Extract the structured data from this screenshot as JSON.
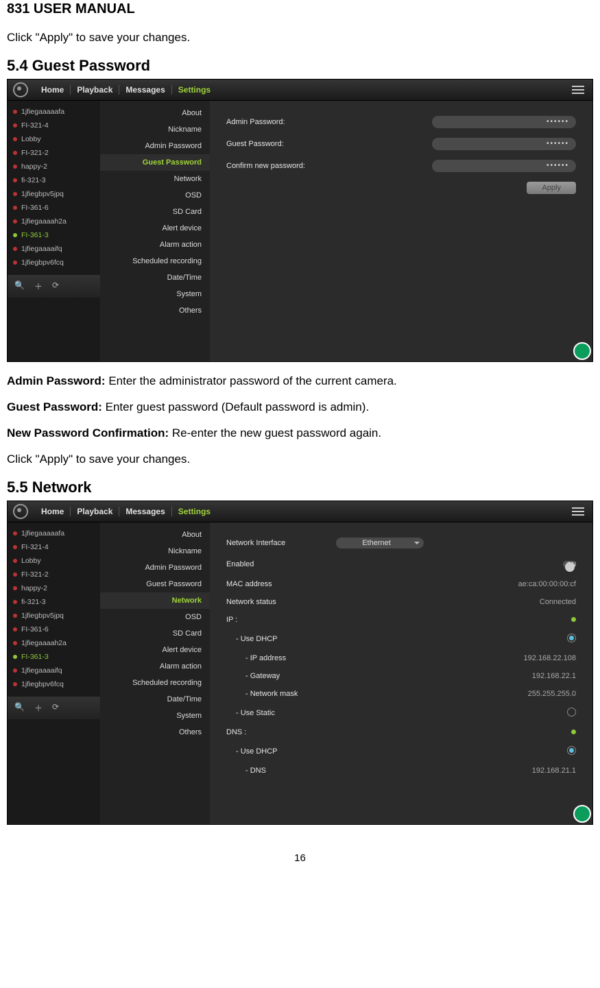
{
  "doc": {
    "title": "831 USER MANUAL",
    "line1": "Click \"Apply\" to save your changes.",
    "sect54": "5.4 Guest Password",
    "sect55": "5.5 Network",
    "admin_lead": "Admin Password: ",
    "admin_txt": "Enter the administrator password of the current camera.",
    "guest_lead": "Guest Password: ",
    "guest_txt": "Enter guest password (Default password is admin).",
    "conf_lead": "New Password Confirmation: ",
    "conf_txt": "Re-enter the new guest password again.",
    "apply_again": "Click \"Apply\" to save your changes.",
    "pagenum": "16"
  },
  "tabs": {
    "home": "Home",
    "playback": "Playback",
    "messages": "Messages",
    "settings": "Settings"
  },
  "devices": [
    {
      "name": "1jfiegaaaaafa",
      "on": false
    },
    {
      "name": "FI-321-4",
      "on": false
    },
    {
      "name": "Lobby",
      "on": false
    },
    {
      "name": "FI-321-2",
      "on": false
    },
    {
      "name": "happy-2",
      "on": false
    },
    {
      "name": "fi-321-3",
      "on": false
    },
    {
      "name": "1jfiegbpv5jpq",
      "on": false
    },
    {
      "name": "FI-361-6",
      "on": false
    },
    {
      "name": "1jfiegaaaah2a",
      "on": false
    },
    {
      "name": "FI-361-3",
      "on": true
    },
    {
      "name": "1jfiegaaaaifq",
      "on": false
    },
    {
      "name": "1jfiegbpv6fcq",
      "on": false
    }
  ],
  "settings_menu": [
    "About",
    "Nickname",
    "Admin Password",
    "Guest Password",
    "Network",
    "OSD",
    "SD Card",
    "Alert device",
    "Alarm action",
    "Scheduled recording",
    "Date/Time",
    "System",
    "Others"
  ],
  "screen1": {
    "active_menu": "Guest Password",
    "fields": {
      "admin": {
        "label": "Admin Password:",
        "value": "••••••"
      },
      "guest": {
        "label": "Guest Password:",
        "value": "••••••"
      },
      "confirm": {
        "label": "Confirm new password:",
        "value": "••••••"
      }
    },
    "apply": "Apply"
  },
  "screen2": {
    "active_menu": "Network",
    "fields": {
      "iface": {
        "label": "Network Interface",
        "value": "Ethernet"
      },
      "enabled": {
        "label": "Enabled",
        "value": "ON"
      },
      "mac": {
        "label": "MAC address",
        "value": "ae:ca:00:00:00:cf"
      },
      "status": {
        "label": "Network status",
        "value": "Connected"
      },
      "ip_head": "IP :",
      "use_dhcp": "- Use DHCP",
      "ipaddr": {
        "label": "- IP address",
        "value": "192.168.22.108"
      },
      "gateway": {
        "label": "- Gateway",
        "value": "192.168.22.1"
      },
      "mask": {
        "label": "- Network mask",
        "value": "255.255.255.0"
      },
      "use_static": "- Use Static",
      "dns_head": "DNS :",
      "dns_dhcp": "- Use DHCP",
      "dns": {
        "label": "- DNS",
        "value": "192.168.21.1"
      }
    }
  }
}
